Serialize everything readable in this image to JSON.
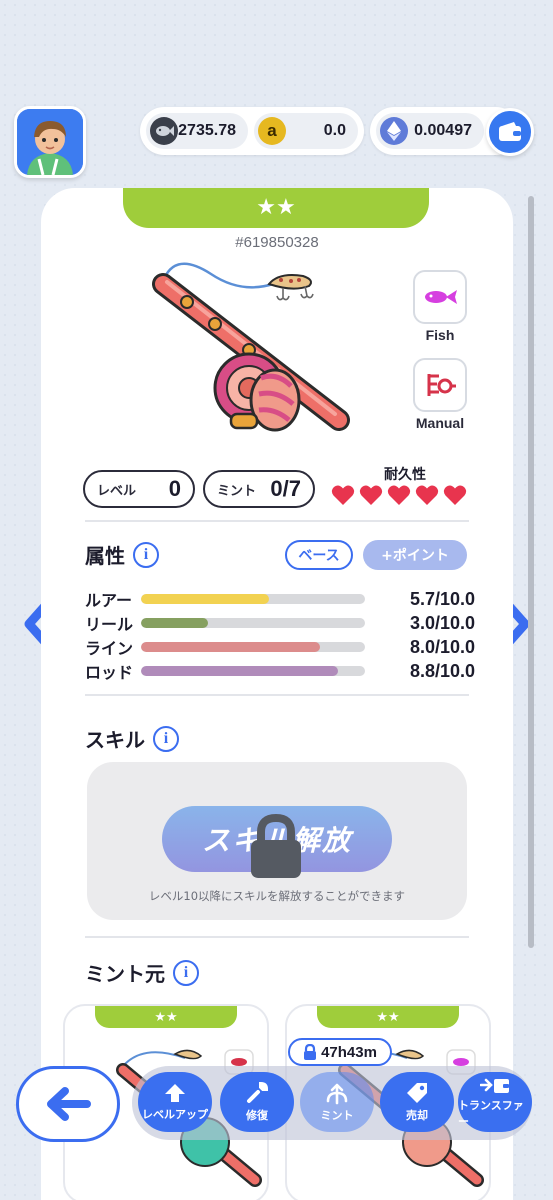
{
  "header": {
    "currencies": [
      {
        "icon": "fish-token-icon",
        "value": "2735.78"
      },
      {
        "icon": "a-token-icon",
        "value": "0.0"
      },
      {
        "icon": "ethereum-icon",
        "value": "0.00497"
      }
    ]
  },
  "card": {
    "stars": "★★",
    "nft_id": "#619850328",
    "type_label": "Fish",
    "mode_label": "Manual",
    "level_label": "レベル",
    "level_value": "0",
    "mint_label": "ミント",
    "mint_value": "0/7",
    "durability_label": "耐久性",
    "durability_hearts": 5
  },
  "attributes": {
    "title": "属性",
    "base_toggle": "ベース",
    "point_toggle": "+ポイント",
    "rows": [
      {
        "name": "ルアー",
        "value": "5.7/10.0",
        "fraction": 0.57,
        "color": "#f2d251"
      },
      {
        "name": "リール",
        "value": "3.0/10.0",
        "fraction": 0.3,
        "color": "#86a060"
      },
      {
        "name": "ライン",
        "value": "8.0/10.0",
        "fraction": 0.8,
        "color": "#dc8c8c"
      },
      {
        "name": "ロッド",
        "value": "8.8/10.0",
        "fraction": 0.88,
        "color": "#b08bba"
      }
    ]
  },
  "skill": {
    "title": "スキル",
    "button": "スキル解放",
    "note": "レベル10以降にスキルを解放することができます"
  },
  "mint_source": {
    "title": "ミント元",
    "cards": [
      {
        "stars": "★★"
      },
      {
        "stars": "★★",
        "timer": "47h43m"
      }
    ]
  },
  "bottom_nav": {
    "items": [
      "レベルアップ",
      "修復",
      "ミント",
      "売却",
      "トランスファー"
    ]
  },
  "colors": {
    "accent_blue": "#3b6df0",
    "star_green": "#9fcd3b",
    "heart_red": "#e8344e"
  }
}
